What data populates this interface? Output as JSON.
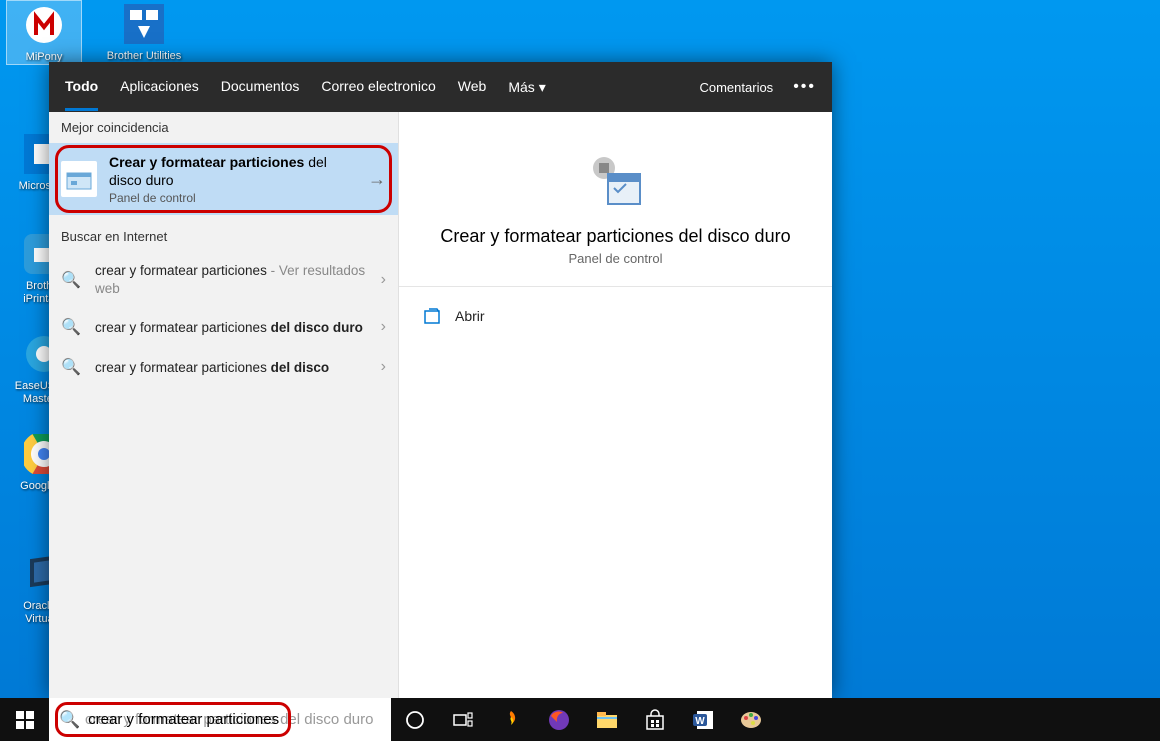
{
  "desktop": {
    "icons": [
      {
        "label": "MiPony"
      },
      {
        "label": "Brother Utilities"
      },
      {
        "label": "Microsof..."
      },
      {
        "label": "Brother\niPrint&..."
      },
      {
        "label": "EaseUS P...\nMaster..."
      },
      {
        "label": "Google ..."
      },
      {
        "label": "Oracle...\nVirtua..."
      }
    ]
  },
  "panel": {
    "tabs": {
      "todo": "Todo",
      "apps": "Aplicaciones",
      "docs": "Documentos",
      "mail": "Correo electronico",
      "web": "Web",
      "more": "Más"
    },
    "comments": "Comentarios",
    "best_section": "Mejor coincidencia",
    "best": {
      "title_a": "Crear y formatear particiones",
      "title_b": " del disco duro",
      "sub": "Panel de control"
    },
    "internet_section": "Buscar en Internet",
    "results": [
      {
        "main": "crear y formatear particiones",
        "suffix": " - Ver resultados web",
        "bold": ""
      },
      {
        "main": "crear y formatear particiones ",
        "suffix": "",
        "bold": "del disco duro"
      },
      {
        "main": "crear y formatear particiones ",
        "suffix": "",
        "bold": "del disco"
      }
    ],
    "detail": {
      "title": "Crear y formatear particiones del disco duro",
      "sub": "Panel de control",
      "open": "Abrir"
    }
  },
  "taskbar": {
    "search_value": "crear y formatear particiones",
    "search_ghost_full": "crear y formatear particiones del disco duro"
  }
}
